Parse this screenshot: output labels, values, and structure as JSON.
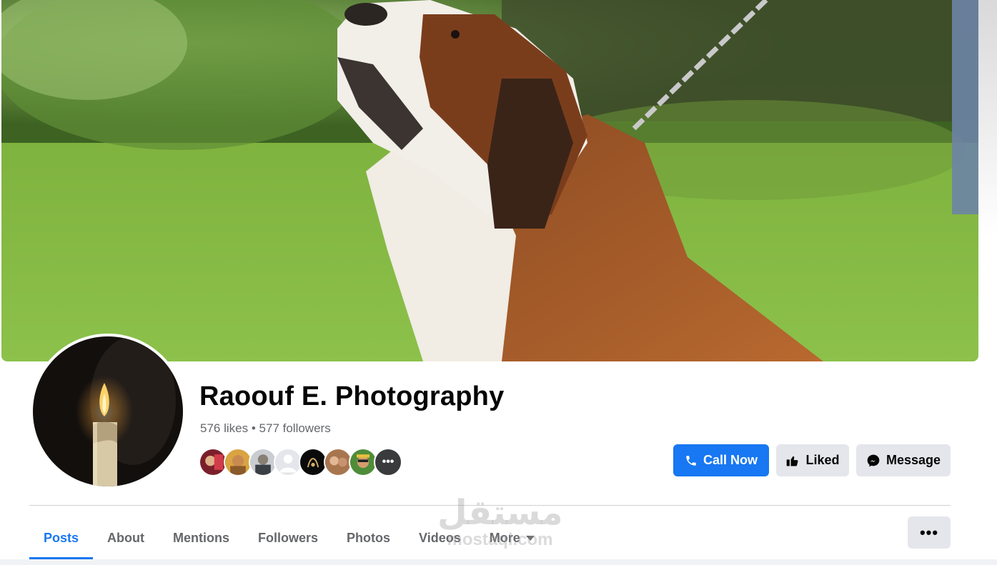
{
  "page": {
    "name": "Raoouf E. Photography",
    "likes_text": "576 likes",
    "separator": "•",
    "followers_text": "577 followers"
  },
  "friend_faces": {
    "count_shown": 8,
    "more_icon": "ellipsis-icon"
  },
  "actions": {
    "call_now": "Call Now",
    "liked": "Liked",
    "message": "Message"
  },
  "tabs": [
    {
      "label": "Posts",
      "active": true
    },
    {
      "label": "About",
      "active": false
    },
    {
      "label": "Mentions",
      "active": false
    },
    {
      "label": "Followers",
      "active": false
    },
    {
      "label": "Photos",
      "active": false
    },
    {
      "label": "Videos",
      "active": false
    },
    {
      "label": "More",
      "active": false
    }
  ],
  "more_options_label": "•••",
  "watermark": {
    "arabic": "مستقل",
    "latin": "mostaql.com"
  },
  "colors": {
    "accent": "#1877f2",
    "secondary_button": "#e4e6eb",
    "muted_text": "#65676b"
  }
}
